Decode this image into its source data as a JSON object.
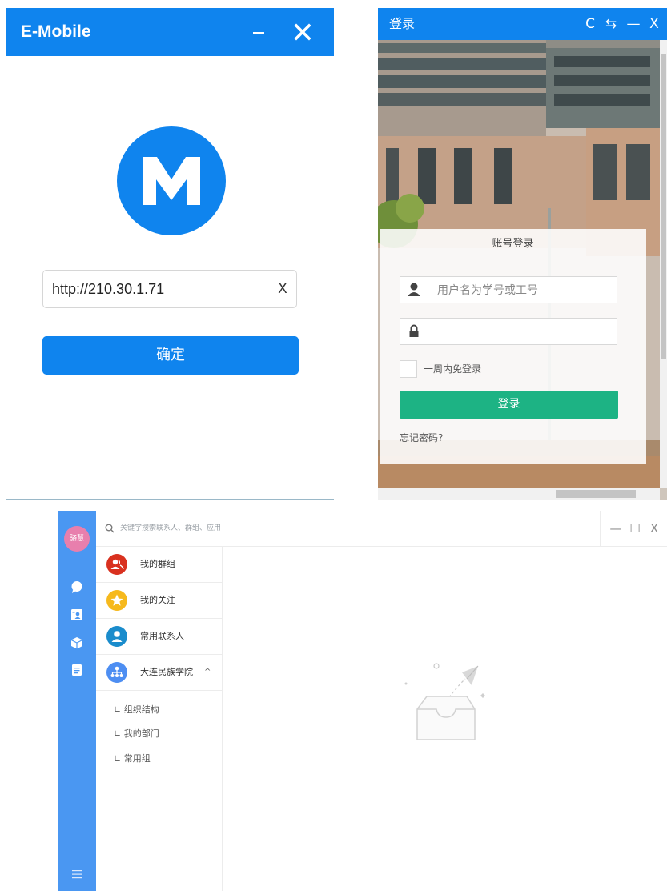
{
  "emobile": {
    "title": "E-Mobile",
    "server_url": "http://210.30.1.71",
    "clear_label": "X",
    "confirm_label": "确定",
    "brand_color": "#0f84ee",
    "logo_icon": "m-logo-icon"
  },
  "login": {
    "title": "登录",
    "toolbar": [
      "refresh-icon",
      "swap-icon",
      "minimize-icon",
      "close-icon"
    ],
    "refresh_label": "C",
    "swap_label": "⇆",
    "minimize_label": "—",
    "close_label": "X",
    "form_title": "账号登录",
    "username_placeholder": "用户名为学号或工号",
    "password_value": "",
    "remember_label": "一周内免登录",
    "login_button": "登录",
    "forgot_label": "忘记密码?",
    "button_color": "#1db384"
  },
  "contacts": {
    "avatar_label": "骆慧",
    "search_placeholder": "关键字搜索联系人、群组、应用",
    "minimize_label": "—",
    "maximize_label": "☐",
    "close_label": "X",
    "nav_icons": [
      "chat-bubble-icon",
      "contacts-card-icon",
      "apps-cube-icon",
      "notes-icon",
      "menu-icon"
    ],
    "items": [
      {
        "label": "我的群组",
        "icon": "group-icon",
        "color": "#d9311f"
      },
      {
        "label": "我的关注",
        "icon": "star-icon",
        "color": "#f6b91d"
      },
      {
        "label": "常用联系人",
        "icon": "person-icon",
        "color": "#1a8ccc"
      },
      {
        "label": "大连民族学院",
        "icon": "org-icon",
        "color": "#4d8ef2"
      }
    ],
    "sub_items": [
      "∟ 组织结构",
      "∟ 我的部门",
      "∟ 常用组"
    ],
    "expand_label": "^",
    "nav_color": "#4a97f2"
  }
}
